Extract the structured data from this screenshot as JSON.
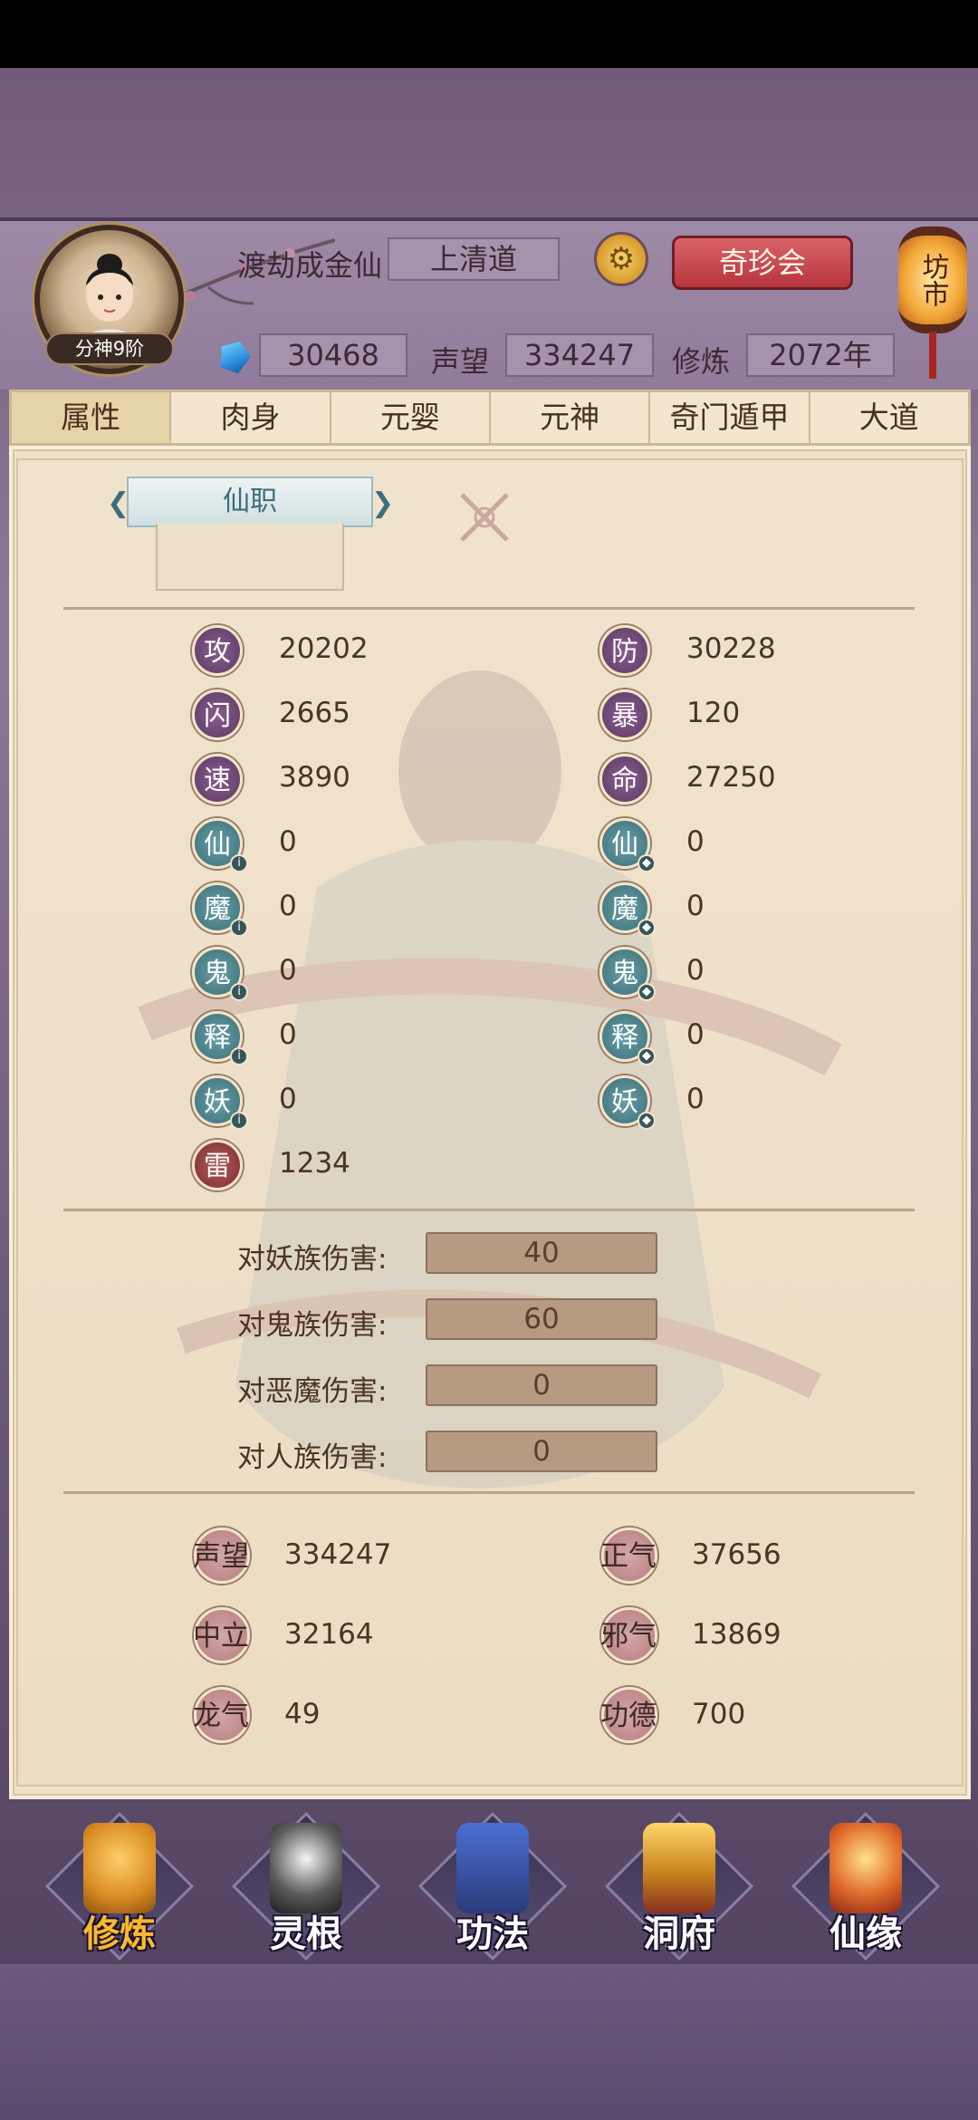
{
  "header": {
    "rank_badge": "分神9阶",
    "title": "渡劫成金仙",
    "sect": "上清道",
    "treasure_button": "奇珍会",
    "market_label": "坊市",
    "spirit_stones": "30468",
    "reputation_label": "声望",
    "reputation_value": "334247",
    "cultivation_label": "修炼",
    "cultivation_value": "2072年"
  },
  "tabs": [
    "属性",
    "肉身",
    "元婴",
    "元神",
    "奇门遁甲",
    "大道"
  ],
  "post": {
    "label": "仙职"
  },
  "attributes": [
    {
      "char": "攻",
      "value": "20202"
    },
    {
      "char": "防",
      "value": "30228"
    },
    {
      "char": "闪",
      "value": "2665"
    },
    {
      "char": "暴",
      "value": "120"
    },
    {
      "char": "速",
      "value": "3890"
    },
    {
      "char": "命",
      "value": "27250"
    },
    {
      "char": "仙",
      "value": "0"
    },
    {
      "char": "仙",
      "value": "0"
    },
    {
      "char": "魔",
      "value": "0"
    },
    {
      "char": "魔",
      "value": "0"
    },
    {
      "char": "鬼",
      "value": "0"
    },
    {
      "char": "鬼",
      "value": "0"
    },
    {
      "char": "释",
      "value": "0"
    },
    {
      "char": "释",
      "value": "0"
    },
    {
      "char": "妖",
      "value": "0"
    },
    {
      "char": "妖",
      "value": "0"
    },
    {
      "char": "雷",
      "value": "1234"
    }
  ],
  "damage_bonus": [
    {
      "label": "对妖族伤害:",
      "value": "40"
    },
    {
      "label": "对鬼族伤害:",
      "value": "60"
    },
    {
      "label": "对恶魔伤害:",
      "value": "0"
    },
    {
      "label": "对人族伤害:",
      "value": "0"
    }
  ],
  "reputation_stats": [
    {
      "label": "声望",
      "value": "334247"
    },
    {
      "label": "正气",
      "value": "37656"
    },
    {
      "label": "中立",
      "value": "32164"
    },
    {
      "label": "邪气",
      "value": "13869"
    },
    {
      "label": "龙气",
      "value": "49"
    },
    {
      "label": "功德",
      "value": "700"
    }
  ],
  "nav": [
    {
      "label": "修炼",
      "icon": "hooded-monk-icon",
      "active": true
    },
    {
      "label": "灵根",
      "icon": "yin-yang-sword-icon"
    },
    {
      "label": "功法",
      "icon": "book-icon"
    },
    {
      "label": "洞府",
      "icon": "pavilion-icon"
    },
    {
      "label": "仙缘",
      "icon": "gourd-icon"
    }
  ],
  "colors": {
    "treasure_button": "#b8343d",
    "nav_active": "#ffb92e",
    "panel_bg": "#efe2ca"
  }
}
